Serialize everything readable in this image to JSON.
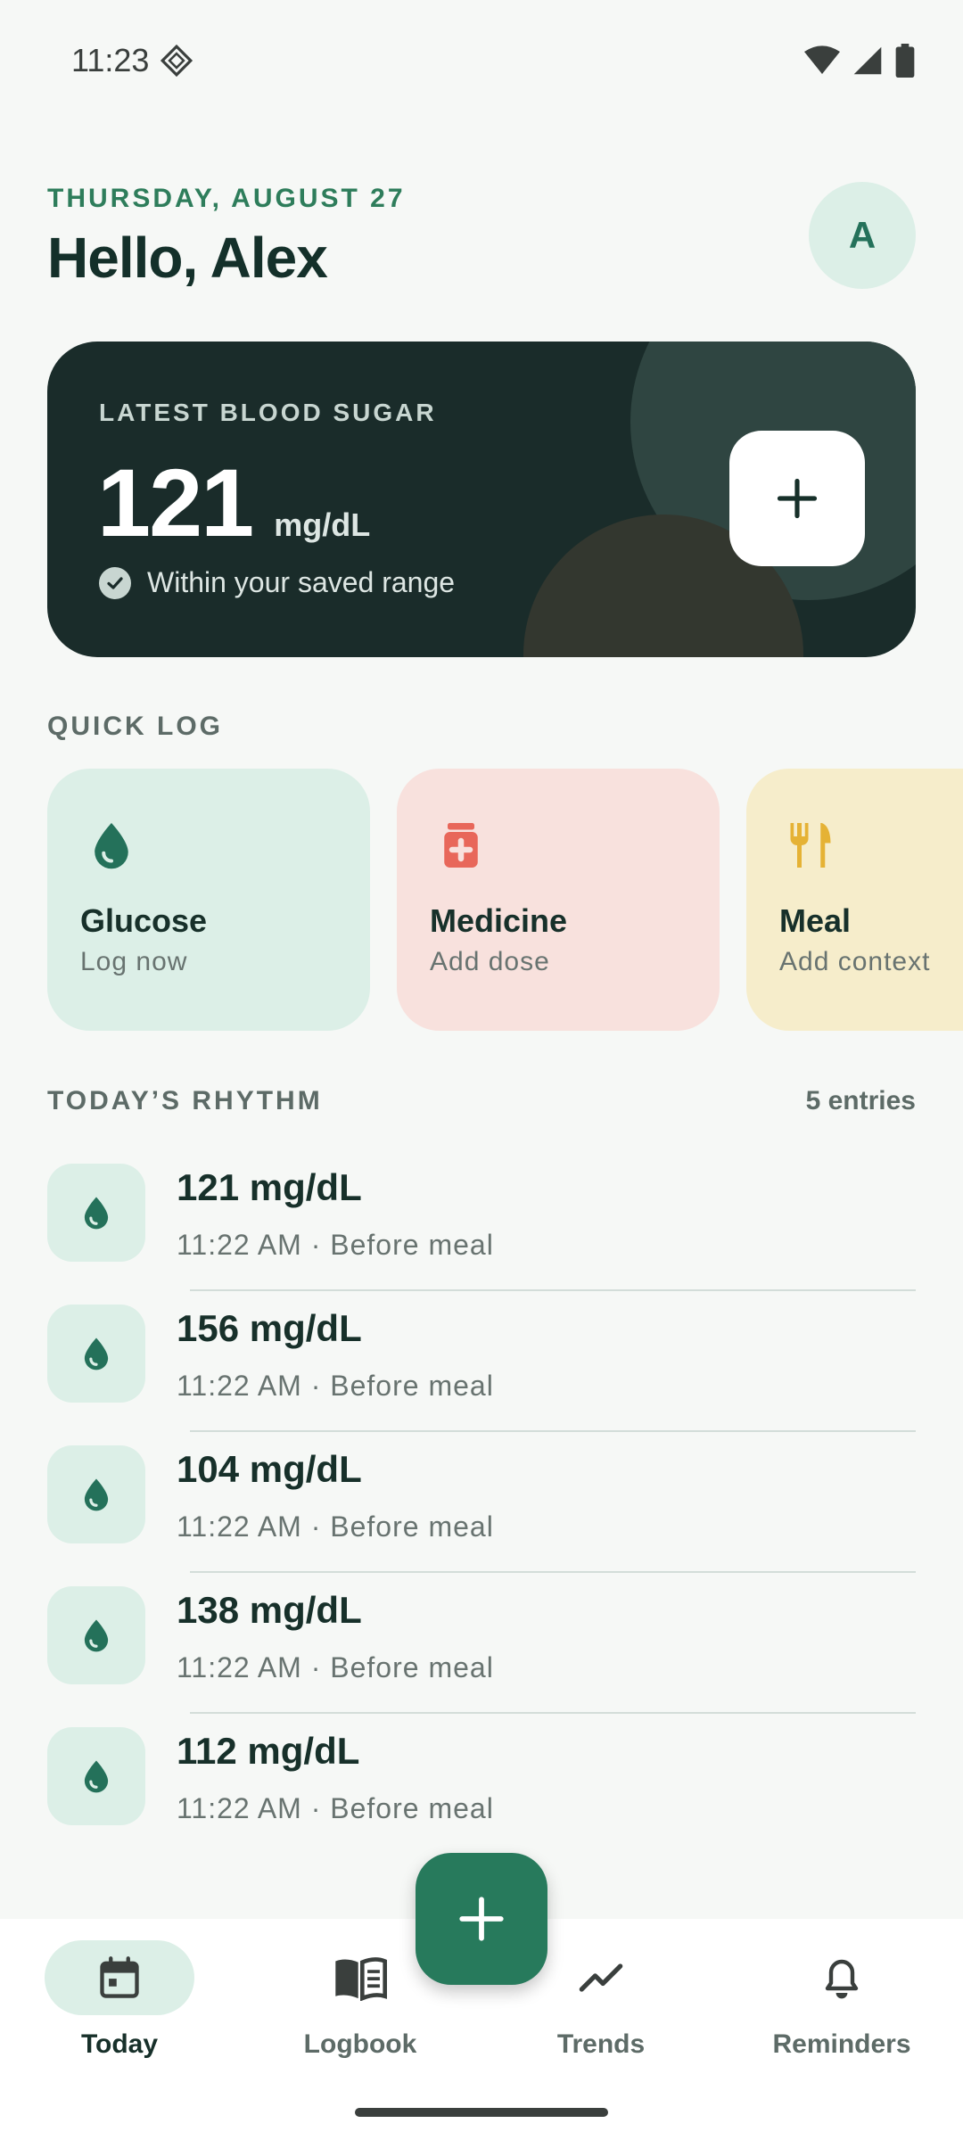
{
  "status_bar": {
    "time": "11:23"
  },
  "header": {
    "date": "THURSDAY, AUGUST 27",
    "greeting": "Hello, Alex",
    "avatar_initial": "A"
  },
  "hero": {
    "label": "LATEST BLOOD SUGAR",
    "value": "121",
    "unit": "mg/dL",
    "status": "Within your saved range"
  },
  "quick_log": {
    "title": "QUICK LOG",
    "cards": [
      {
        "title": "Glucose",
        "subtitle": "Log now",
        "icon": "drop-icon",
        "bg": "#DCEFE7",
        "color": "#24715A"
      },
      {
        "title": "Medicine",
        "subtitle": "Add dose",
        "icon": "medicine-bottle-icon",
        "bg": "#F8E1DD",
        "color": "#E8675A"
      },
      {
        "title": "Meal",
        "subtitle": "Add context",
        "icon": "fork-knife-icon",
        "bg": "#F6EDCB",
        "color": "#E5B235"
      }
    ]
  },
  "rhythm": {
    "title": "TODAY’S RHYTHM",
    "count": "5 entries",
    "entries": [
      {
        "value": "121 mg/dL",
        "meta": "11:22 AM · Before meal"
      },
      {
        "value": "156 mg/dL",
        "meta": "11:22 AM · Before meal"
      },
      {
        "value": "104 mg/dL",
        "meta": "11:22 AM · Before meal"
      },
      {
        "value": "138 mg/dL",
        "meta": "11:22 AM · Before meal"
      },
      {
        "value": "112 mg/dL",
        "meta": "11:22 AM · Before meal"
      }
    ]
  },
  "nav": {
    "items": [
      {
        "label": "Today",
        "icon": "calendar-icon",
        "active": true
      },
      {
        "label": "Logbook",
        "icon": "book-icon",
        "active": false
      },
      {
        "label": "Trends",
        "icon": "trend-line-icon",
        "active": false
      },
      {
        "label": "Reminders",
        "icon": "bell-icon",
        "active": false
      }
    ]
  },
  "colors": {
    "accent": "#277A5C",
    "hero_bg": "#1A2C2A",
    "background": "#F6F8F6"
  }
}
